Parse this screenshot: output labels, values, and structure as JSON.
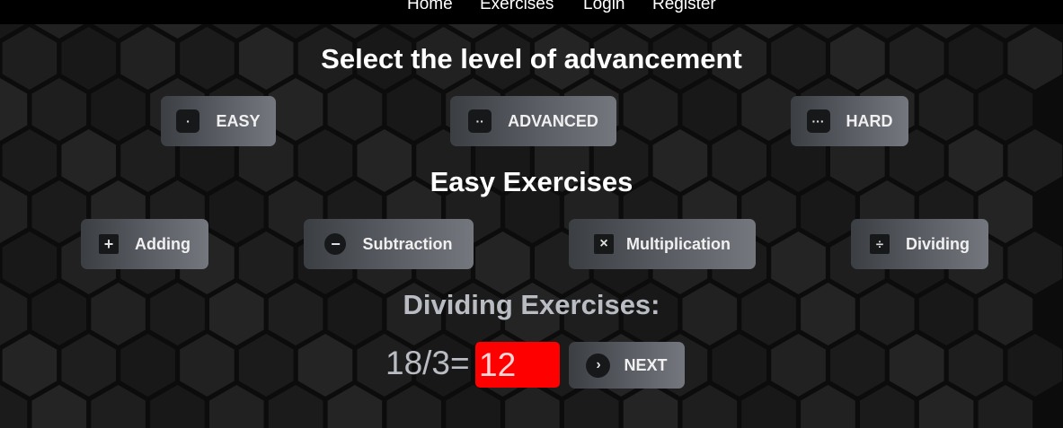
{
  "nav": {
    "items": [
      "Home",
      "Exercises",
      "Login",
      "Register"
    ]
  },
  "level_section": {
    "title": "Select the level of advancement",
    "levels": [
      {
        "label": "EASY",
        "icon": "dice-one-icon"
      },
      {
        "label": "ADVANCED",
        "icon": "dice-two-icon"
      },
      {
        "label": "HARD",
        "icon": "dice-three-icon"
      }
    ]
  },
  "exercise_section": {
    "title": "Easy Exercises",
    "operations": [
      {
        "label": "Adding",
        "icon": "plus-square-icon"
      },
      {
        "label": "Subtraction",
        "icon": "minus-circle-icon"
      },
      {
        "label": "Multiplication",
        "icon": "times-square-icon"
      },
      {
        "label": "Dividing",
        "icon": "divide-square-icon"
      }
    ]
  },
  "quiz": {
    "title": "Dividing Exercises:",
    "question": "18/3=",
    "answer_value": "12",
    "next_label": "NEXT",
    "answer_bg": "#ff0000"
  }
}
